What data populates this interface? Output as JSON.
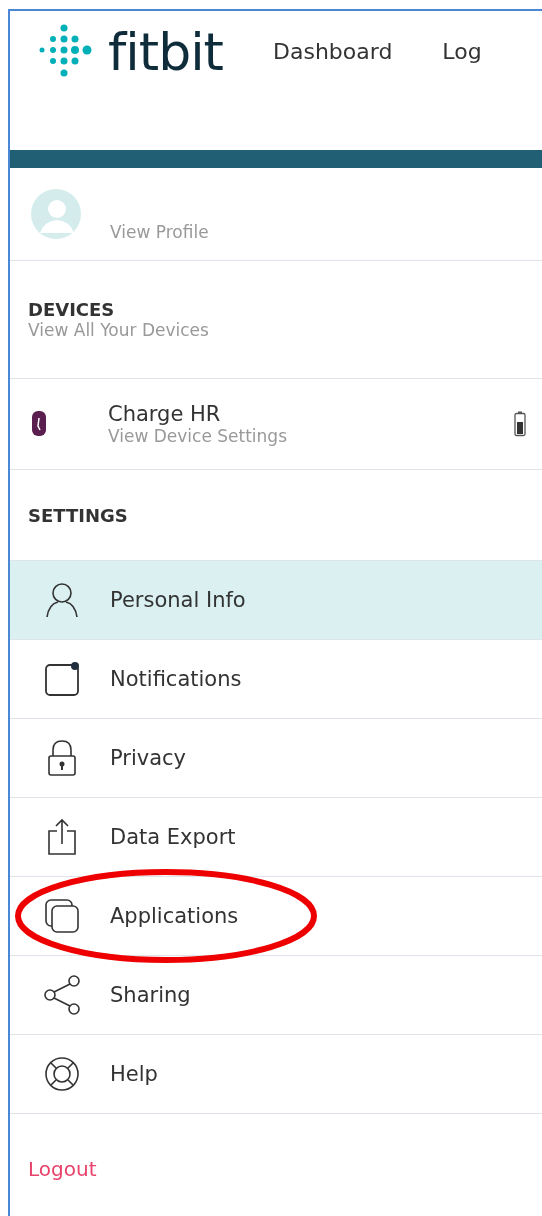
{
  "header": {
    "logo": "fitbit",
    "nav": [
      {
        "label": "Dashboard"
      },
      {
        "label": "Log"
      }
    ]
  },
  "profile": {
    "link": "View Profile"
  },
  "devices": {
    "heading": "DEVICES",
    "link": "View All Your Devices",
    "items": [
      {
        "name": "Charge HR",
        "link": "View Device Settings"
      }
    ]
  },
  "settings": {
    "heading": "SETTINGS",
    "items": [
      {
        "label": "Personal Info",
        "selected": true,
        "circled": false
      },
      {
        "label": "Notifications",
        "selected": false,
        "circled": false
      },
      {
        "label": "Privacy",
        "selected": false,
        "circled": false
      },
      {
        "label": "Data Export",
        "selected": false,
        "circled": false
      },
      {
        "label": "Applications",
        "selected": false,
        "circled": true
      },
      {
        "label": "Sharing",
        "selected": false,
        "circled": false
      },
      {
        "label": "Help",
        "selected": false,
        "circled": false
      }
    ]
  },
  "logout": "Logout"
}
